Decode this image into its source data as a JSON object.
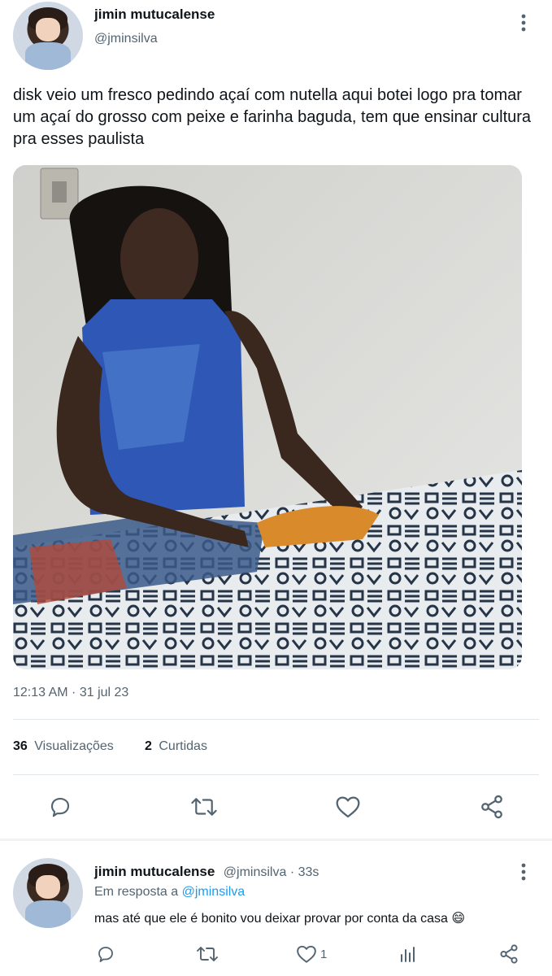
{
  "tweet": {
    "author": {
      "display_name": "jimin mutucalense",
      "handle": "@jminsilva"
    },
    "text": "disk veio um fresco pedindo açaí com nutella aqui botei logo pra tomar um açaí do grosso com peixe e farinha baguda, tem que ensinar cultura pra esses paulista",
    "timestamp": "12:13 AM · 31 jul 23",
    "stats": {
      "views_count": "36",
      "views_label": "Visualizações",
      "likes_count": "2",
      "likes_label": "Curtidas"
    },
    "actions": [
      "reply-icon",
      "retweet-icon",
      "like-icon",
      "share-icon"
    ]
  },
  "reply": {
    "author": {
      "display_name": "jimin mutucalense",
      "handle": "@jminsilva · 33s"
    },
    "replying_prefix": "Em resposta a",
    "replying_to": "@jminsilva",
    "text": "mas até que ele é bonito vou deixar provar por conta da casa 😄",
    "like_count": "1"
  },
  "colors": {
    "accent": "#1d9bf0",
    "secondary_text": "#536471",
    "divider": "#e1e6ea"
  }
}
